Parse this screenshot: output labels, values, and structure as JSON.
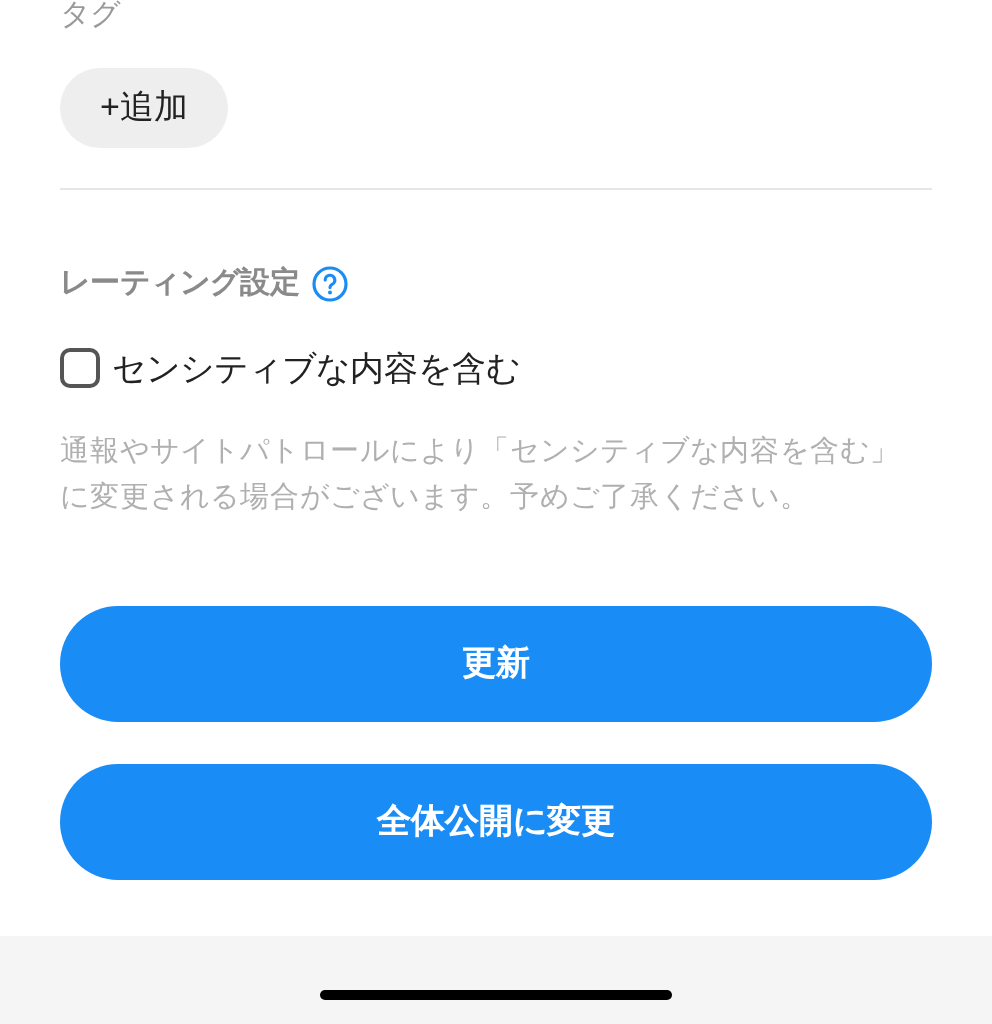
{
  "tags": {
    "label": "タグ",
    "add_button": "+追加"
  },
  "rating": {
    "title": "レーティング設定",
    "sensitive": {
      "label": "センシティブな内容を含む",
      "checked": false
    },
    "note": "通報やサイトパトロールにより「センシティブな内容を含む」に変更される場合がございます。予めご了承ください。"
  },
  "buttons": [
    "更新",
    "全体公開に変更"
  ]
}
